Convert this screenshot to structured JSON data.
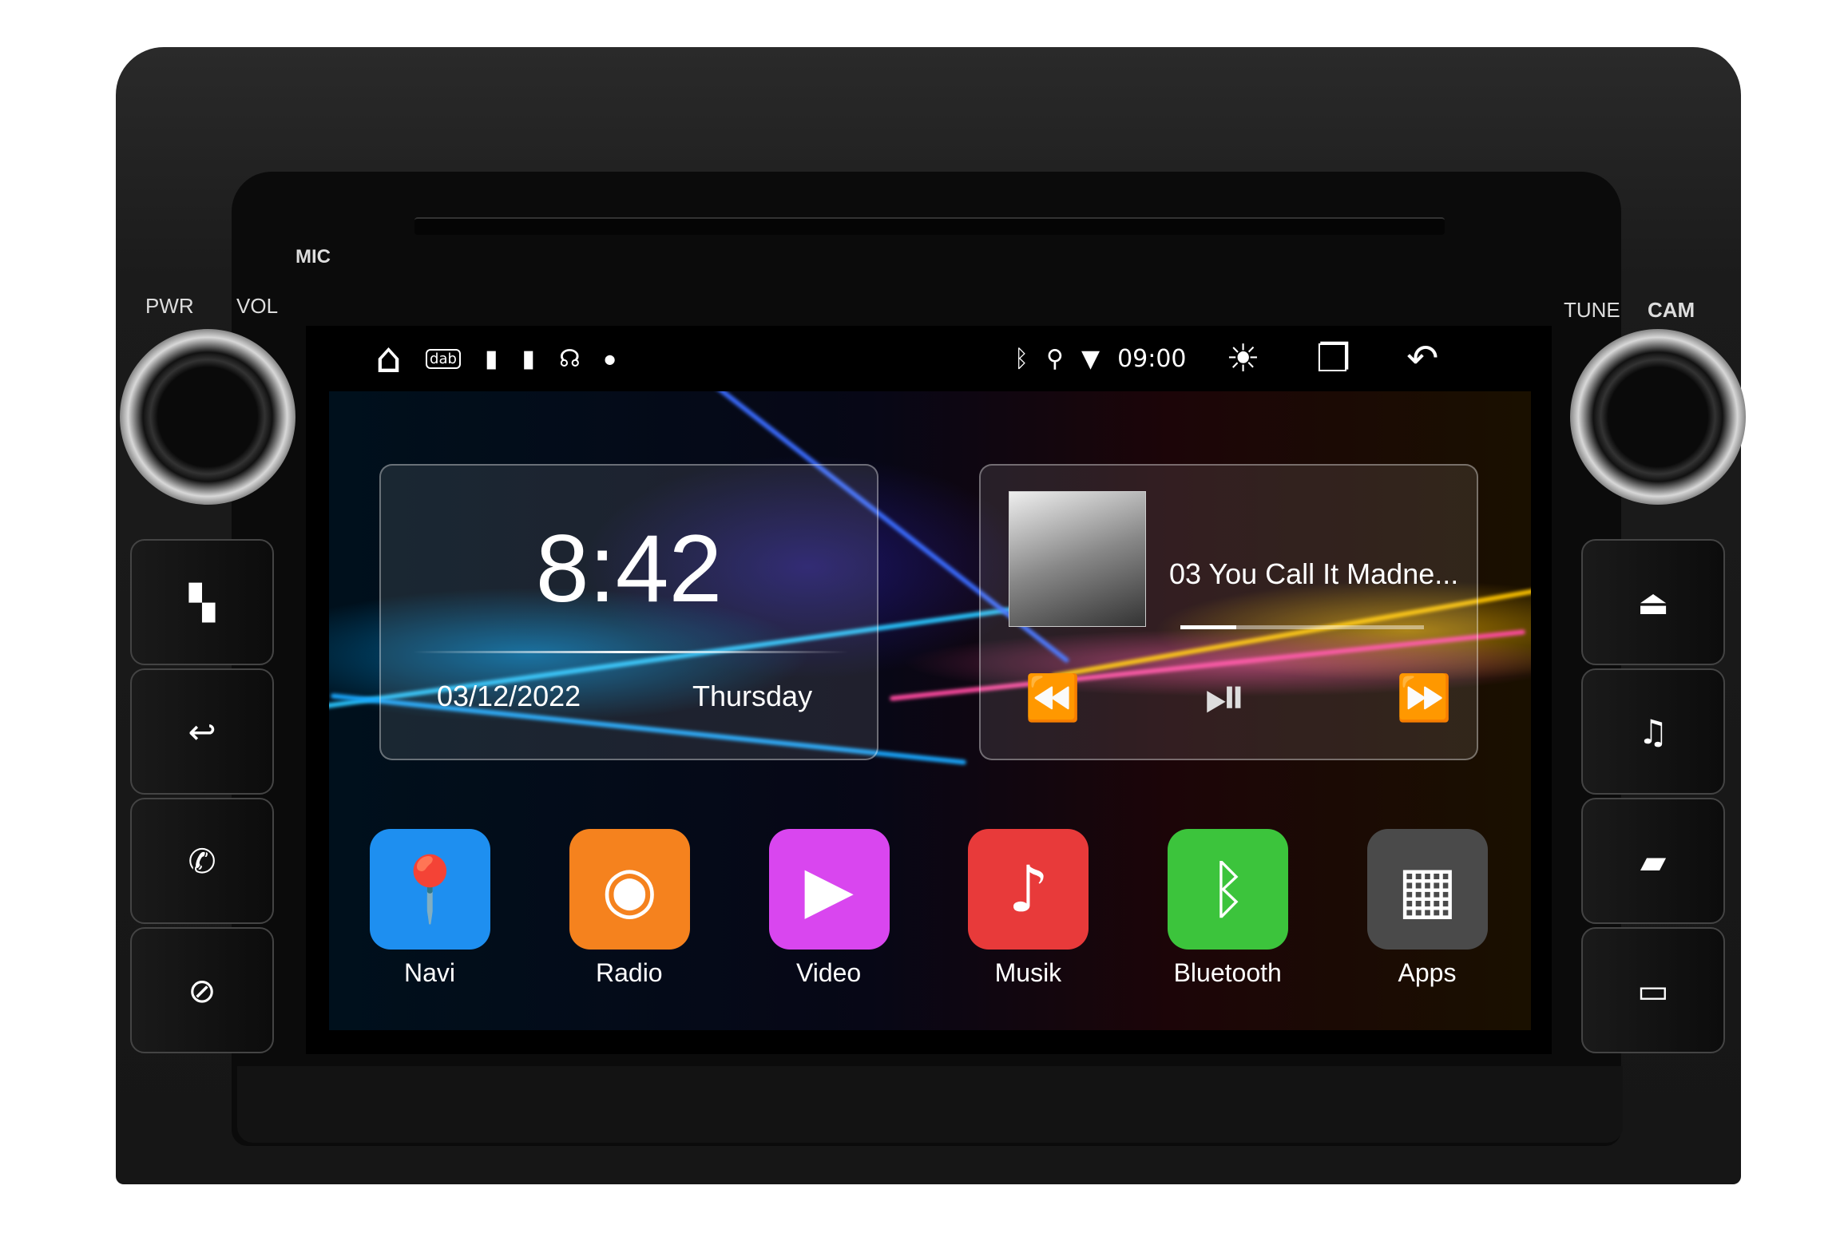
{
  "device_labels": {
    "pwr": "PWR",
    "vol": "VOL",
    "mic": "MIC",
    "tune": "TUNE",
    "cam": "CAM"
  },
  "left_buttons": [
    {
      "icon": "apps-grid-icon",
      "glyph": "▚"
    },
    {
      "icon": "back-icon",
      "glyph": "↩"
    },
    {
      "icon": "phone-icon",
      "glyph": "✆"
    },
    {
      "icon": "navigation-icon",
      "glyph": "⊘"
    }
  ],
  "right_buttons": [
    {
      "icon": "eject-icon",
      "glyph": "⏏"
    },
    {
      "icon": "music-icon",
      "glyph": "♫"
    },
    {
      "icon": "radio-icon",
      "glyph": "▰"
    },
    {
      "icon": "sd-card-icon",
      "glyph": "▭"
    }
  ],
  "status_bar": {
    "time": "09:00",
    "left_icons": [
      "home-icon",
      "dab-icon",
      "usb-icon",
      "usb-icon",
      "call-icon",
      "dot-icon"
    ],
    "right_icons": [
      "bluetooth-icon",
      "location-icon",
      "wifi-icon",
      "brightness-icon",
      "recent-apps-icon",
      "back-icon"
    ]
  },
  "clock_widget": {
    "time": "8:42",
    "date": "03/12/2022",
    "weekday": "Thursday"
  },
  "music_widget": {
    "track": "03 You Call It Madne...",
    "progress_percent": 23
  },
  "apps": [
    {
      "label": "Navi",
      "icon": "location-pin-icon",
      "color": "#1e8ff0"
    },
    {
      "label": "Radio",
      "icon": "podcast-radio-icon",
      "color": "#f5821e"
    },
    {
      "label": "Video",
      "icon": "play-icon",
      "color": "#d946ef"
    },
    {
      "label": "Musik",
      "icon": "music-note-icon",
      "color": "#e83a3a"
    },
    {
      "label": "Bluetooth",
      "icon": "bluetooth-icon",
      "color": "#3cc43c"
    },
    {
      "label": "Apps",
      "icon": "apps-grid-icon",
      "color": "#4a4a4a"
    }
  ]
}
